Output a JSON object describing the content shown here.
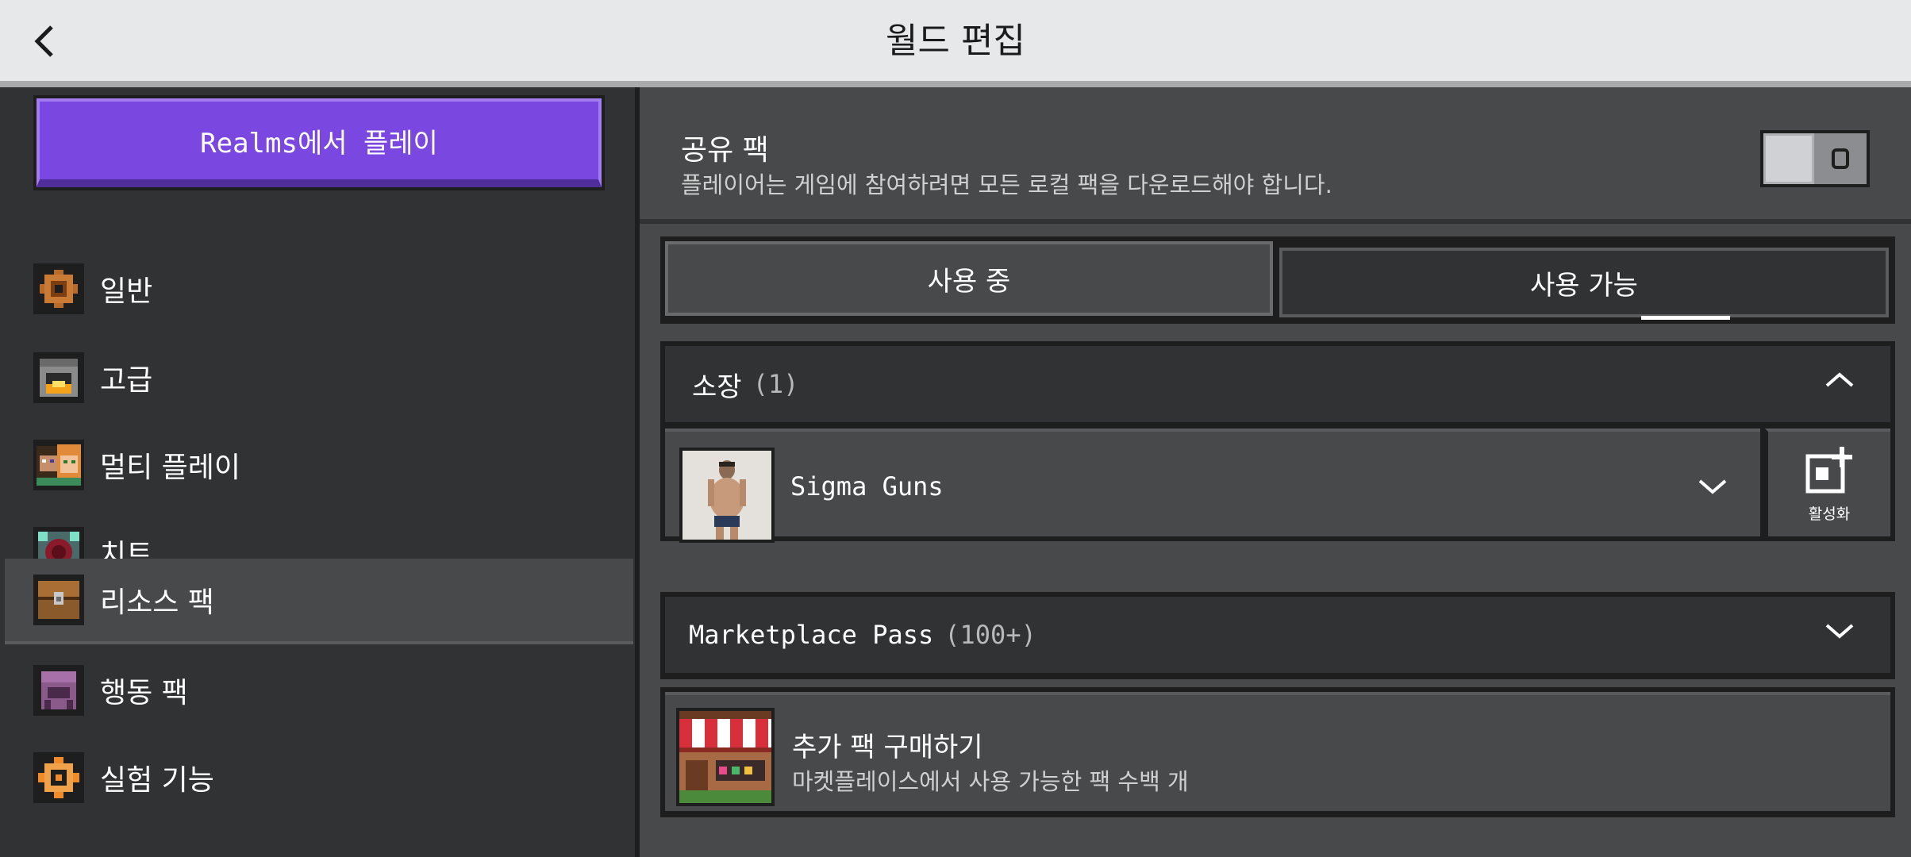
{
  "header": {
    "title": "월드 편집"
  },
  "sidebar": {
    "realms_button": "Realms에서 플레이",
    "items": [
      {
        "label": "일반",
        "icon": "gear-icon"
      },
      {
        "label": "고급",
        "icon": "furnace-icon"
      },
      {
        "label": "멀티 플레이",
        "icon": "players-icon"
      },
      {
        "label": "치트",
        "icon": "command-block-icon"
      },
      {
        "label": "리소스 팩",
        "icon": "chest-icon",
        "active": true
      },
      {
        "label": "행동 팩",
        "icon": "behavior-pack-icon"
      },
      {
        "label": "실험 기능",
        "icon": "experiment-icon"
      }
    ]
  },
  "shared_pack": {
    "title": "공유 팩",
    "description": "플레이어는 게임에 참여하려면 모든 로컬 팩을 다운로드해야 합니다.",
    "toggle_on": false
  },
  "tabs": {
    "in_use": "사용 중",
    "available": "사용 가능",
    "selected": "available"
  },
  "owned": {
    "label": "소장",
    "count": "(1)",
    "packs": [
      {
        "name": "Sigma Guns",
        "action": "활성화"
      }
    ]
  },
  "marketplace": {
    "label": "Marketplace Pass",
    "count": "(100+)"
  },
  "buy_more": {
    "title": "추가 팩 구매하기",
    "subtitle": "마켓플레이스에서 사용 가능한 팩 수백 개"
  },
  "colors": {
    "accent": "#7a47e0",
    "panel": "#48494a",
    "dark": "#313233",
    "border": "#1e1e1f"
  }
}
